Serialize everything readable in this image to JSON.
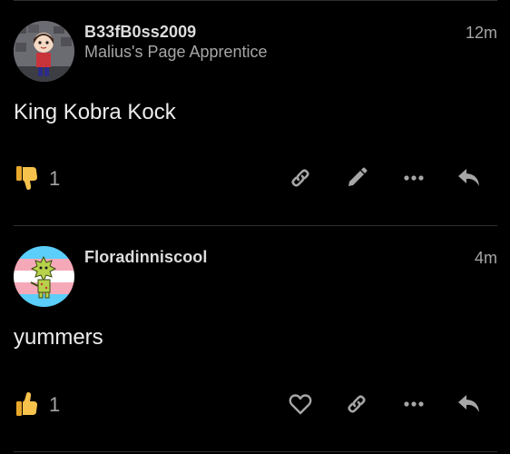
{
  "posts": [
    {
      "username": "B33fB0ss2009",
      "user_title": "Malius's Page Apprentice",
      "time": "12m",
      "body": "King Kobra Kock",
      "reaction_icon": "thumbs-down-icon",
      "reaction_count": "1",
      "actions": [
        "link-icon",
        "pencil-icon",
        "more-icon",
        "reply-icon"
      ]
    },
    {
      "username": "Floradinniscool",
      "user_title": "",
      "time": "4m",
      "body": "yummers",
      "reaction_icon": "thumbs-up-icon",
      "reaction_count": "1",
      "actions": [
        "heart-icon",
        "link-icon",
        "more-icon",
        "reply-icon"
      ]
    }
  ],
  "colors": {
    "background": "#000000",
    "emoji_yellow": "#F6C24C",
    "icon_gray": "#a6a6a6",
    "divider": "#2e2e2e"
  }
}
